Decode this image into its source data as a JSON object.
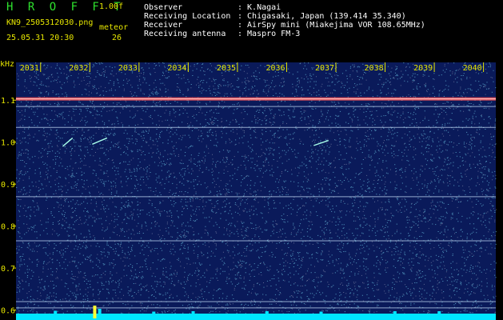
{
  "header": {
    "app_title": "H R O F F T",
    "version": "1.00f",
    "filename": "KN9_2505312030.png",
    "datetime": "25.05.31 20:30",
    "meteor_label": "meteor",
    "meteor_count": "26"
  },
  "info": [
    {
      "label": "Observer",
      "value": ": K.Nagai"
    },
    {
      "label": "Receiving Location",
      "value": ": Chigasaki, Japan (139.414 35.340)"
    },
    {
      "label": "Receiver",
      "value": ": AirSpy mini (Miakejima VOR 108.65MHz)"
    },
    {
      "label": "Receiving antenna",
      "value": ": Maspro FM-3"
    }
  ],
  "colors": {
    "background": "#0a1a5a",
    "noise_cyan": "#7fe8ff",
    "carrier": "#ff5a5a",
    "label_yellow": "#e6e600",
    "title_green": "#2ee02e",
    "meteor_bar": "#00e5ff"
  },
  "chart_data": {
    "type": "heatmap",
    "ylabel": "kHz",
    "y_ticks": [
      "1.1",
      "1.0",
      "0.9",
      "0.8",
      "0.7",
      "0.6"
    ],
    "y_tick_values": [
      1.1,
      1.0,
      0.9,
      0.8,
      0.7,
      0.6
    ],
    "ylim": [
      0.58,
      1.19
    ],
    "x_ticks": [
      "2031",
      "2032",
      "2033",
      "2034",
      "2035",
      "2036",
      "2037",
      "2038",
      "2039",
      "2040"
    ],
    "x_tick_values": [
      2031,
      2032,
      2033,
      2034,
      2035,
      2036,
      2037,
      2038,
      2039,
      2040
    ],
    "xlim": [
      2030.5,
      2040.25
    ],
    "horizontal_lines_khz": [
      1.103,
      1.085,
      1.035,
      0.87,
      0.765,
      0.62,
      0.605
    ],
    "meteor_trails": [
      {
        "x0": 2031.45,
        "x1": 2031.65,
        "y0": 0.99,
        "y1": 1.01
      },
      {
        "x0": 2032.05,
        "x1": 2032.35,
        "y0": 0.995,
        "y1": 1.01
      },
      {
        "x0": 2036.55,
        "x1": 2036.85,
        "y0": 0.992,
        "y1": 1.004
      }
    ],
    "meteor_counts": [
      {
        "x": 2032.1,
        "v": 1.0
      },
      {
        "x": 2032.2,
        "v": 0.6
      },
      {
        "x": 2031.3,
        "v": 0.35
      },
      {
        "x": 2034.1,
        "v": 0.3
      },
      {
        "x": 2035.6,
        "v": 0.3
      },
      {
        "x": 2038.2,
        "v": 0.3
      },
      {
        "x": 2039.1,
        "v": 0.3
      },
      {
        "x": 2033.3,
        "v": 0.25
      },
      {
        "x": 2036.7,
        "v": 0.25
      }
    ]
  }
}
